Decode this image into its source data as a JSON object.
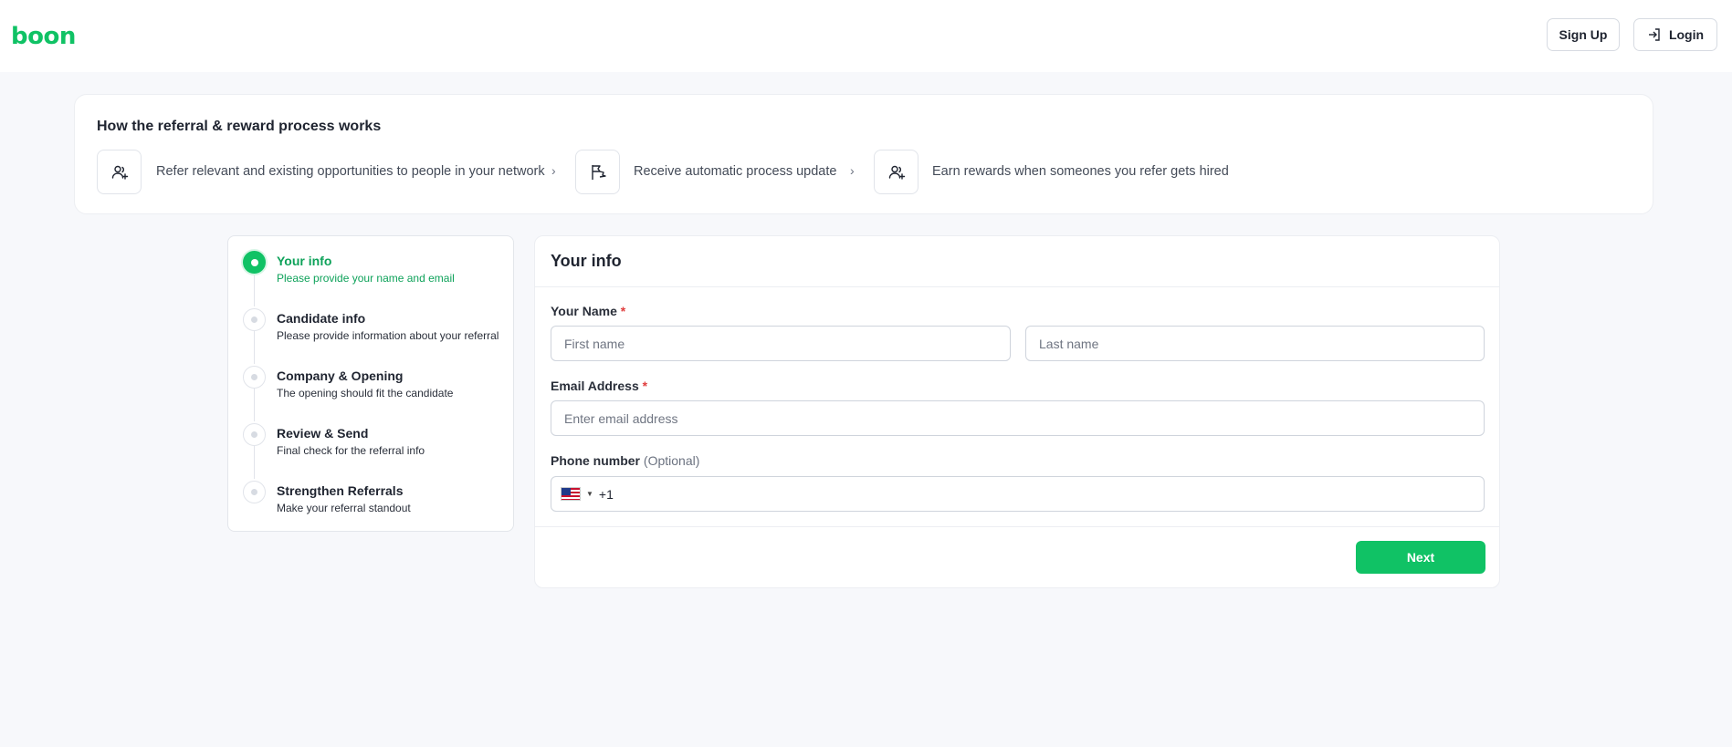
{
  "header": {
    "logo_text": "boon",
    "signup_label": "Sign Up",
    "login_label": "Login"
  },
  "how_it_works": {
    "title": "How the referral & reward process works",
    "steps": [
      {
        "icon": "user-plus-icon",
        "text": "Refer relevant and existing opportunities to people in your network"
      },
      {
        "icon": "flag-icon",
        "text": "Receive automatic process update"
      },
      {
        "icon": "user-plus-icon",
        "text": "Earn rewards when someones you refer gets hired"
      }
    ],
    "separator": "›"
  },
  "steps": [
    {
      "title": "Your info",
      "subtitle": "Please provide your name and email",
      "active": true
    },
    {
      "title": "Candidate info",
      "subtitle": "Please provide information about your referral",
      "active": false
    },
    {
      "title": "Company & Opening",
      "subtitle": "The opening should fit the candidate",
      "active": false
    },
    {
      "title": "Review & Send",
      "subtitle": "Final check for the referral info",
      "active": false
    },
    {
      "title": "Strengthen Referrals",
      "subtitle": "Make your referral standout",
      "active": false
    }
  ],
  "form": {
    "title": "Your info",
    "name_label": "Your Name",
    "required_mark": "*",
    "first_name_placeholder": "First name",
    "last_name_placeholder": "Last name",
    "email_label": "Email Address",
    "email_placeholder": "Enter email address",
    "phone_label": "Phone number",
    "phone_optional": "(Optional)",
    "phone_country": "US",
    "phone_code": "+1",
    "next_label": "Next"
  },
  "colors": {
    "brand": "#10c265",
    "required": "#e03e3e"
  }
}
